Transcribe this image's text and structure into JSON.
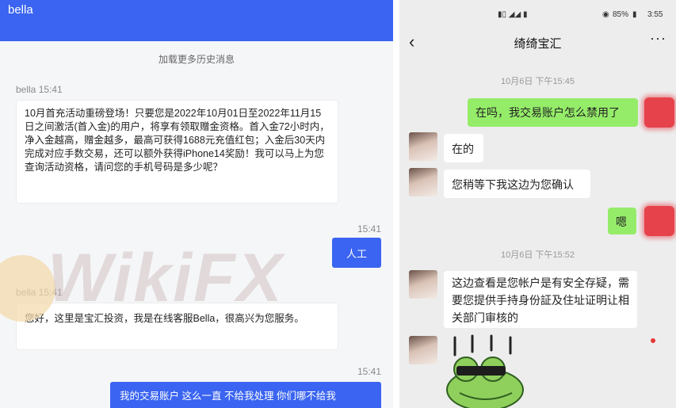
{
  "left_chat": {
    "header_title": "bella",
    "load_more": "加载更多历史消息",
    "messages": [
      {
        "sender": "bella",
        "time": "bella 15:41",
        "text": "10月首充活动重磅登场！只要您是2022年10月01日至2022年11月15日之间激活(首入金)的用户，将享有领取赠金资格。首入金72小时内，净入金越高，赠金越多，最高可获得1688元充值红包；入金后30天内完成对应手数交易，还可以额外获得iPhone14奖励！我可以马上为您查询活动资格，请问您的手机号码是多少呢？"
      },
      {
        "sender": "me",
        "time": "15:41",
        "text": "人工"
      },
      {
        "sender": "bella",
        "time": "bella 15:41",
        "text": "您好，这里是宝汇投资，我是在线客服Bella，很高兴为您服务。"
      },
      {
        "sender": "me",
        "time": "15:41",
        "text": "我的交易账户 这么一直 不给我处理 你们哪不给我"
      }
    ]
  },
  "watermark": {
    "text": "WikiFX"
  },
  "status_bar": {
    "battery": "85%",
    "time": "3:55",
    "signal": "▮▯ ◢◢ ▮"
  },
  "wechat": {
    "title": "绮绮宝汇",
    "back_icon": "‹",
    "more_icon": "···",
    "timestamps": [
      "10月6日 下午15:45",
      "10月6日 下午15:52"
    ],
    "messages": [
      {
        "from": "me",
        "text": "在吗，我交易账户怎么禁用了"
      },
      {
        "from": "agent",
        "text": "在的"
      },
      {
        "from": "agent",
        "text": "您稍等下我这边为您确认"
      },
      {
        "from": "me",
        "text": "嗯"
      },
      {
        "from": "agent",
        "text": "这边查看是您帐户是有安全存疑，需要您提供手持身份証及住址证明让相关部门审核的"
      },
      {
        "from": "agent",
        "text": "",
        "sticker": "frog-sticker"
      }
    ]
  },
  "colors": {
    "accent_blue": "#3a64f1",
    "wechat_green": "#95ec69",
    "wechat_bg": "#ededed"
  }
}
